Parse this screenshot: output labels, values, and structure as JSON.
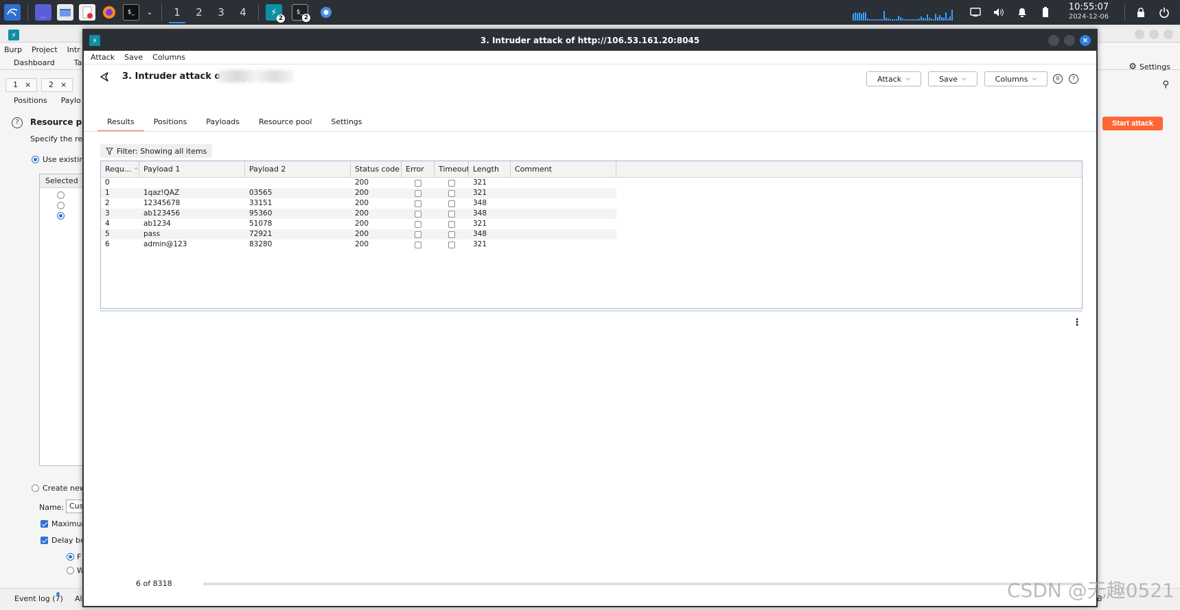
{
  "taskbar": {
    "workspaces": [
      "1",
      "2",
      "3",
      "4"
    ],
    "active_workspace": "1",
    "burp_badge": "2",
    "terminal_badge": "2",
    "clock_time": "10:55:07",
    "clock_date": "2024-12-06"
  },
  "background_app": {
    "menu": [
      "Burp",
      "Project",
      "Intr"
    ],
    "tabs": [
      "Dashboard",
      "Ta"
    ],
    "number_tabs": [
      "1",
      "2"
    ],
    "subtabs": [
      "Positions",
      "Paylo"
    ],
    "section_title": "Resource poo",
    "section_desc": "Specify the reso",
    "use_existing": "Use existing",
    "selected_header": "Selected",
    "create_new": "Create new",
    "name_label": "Name:",
    "name_value": "Cus",
    "maximum_label": "Maximun",
    "delay_label": "Delay bet",
    "radio_f": "F",
    "radio_w": "W",
    "settings_label": "Settings",
    "start_attack": "Start attack",
    "event_log": "Event log (7)",
    "all_label": "Al",
    "bottom_right_label": "B"
  },
  "window": {
    "title": "3. Intruder attack of http://106.53.161.20:8045",
    "menu": [
      "Attack",
      "Save",
      "Columns"
    ],
    "heading": "3. Intruder attack of http",
    "buttons": {
      "attack": "Attack",
      "save": "Save",
      "columns": "Columns"
    },
    "tabs": [
      "Results",
      "Positions",
      "Payloads",
      "Resource pool",
      "Settings"
    ],
    "active_tab": "Results",
    "filter_text": "Filter: Showing all items",
    "columns": [
      "Requ...",
      "Payload 1",
      "Payload 2",
      "Status code",
      "Error",
      "Timeout",
      "Length",
      "Comment"
    ],
    "rows": [
      {
        "request": "0",
        "payload1": "",
        "payload2": "",
        "status": "200",
        "error": false,
        "timeout": false,
        "length": "321",
        "comment": ""
      },
      {
        "request": "1",
        "payload1": "1qaz!QAZ",
        "payload2": "03565",
        "status": "200",
        "error": false,
        "timeout": false,
        "length": "321",
        "comment": ""
      },
      {
        "request": "2",
        "payload1": "12345678",
        "payload2": "33151",
        "status": "200",
        "error": false,
        "timeout": false,
        "length": "348",
        "comment": ""
      },
      {
        "request": "3",
        "payload1": "ab123456",
        "payload2": "95360",
        "status": "200",
        "error": false,
        "timeout": false,
        "length": "348",
        "comment": ""
      },
      {
        "request": "4",
        "payload1": "ab1234",
        "payload2": "51078",
        "status": "200",
        "error": false,
        "timeout": false,
        "length": "321",
        "comment": ""
      },
      {
        "request": "5",
        "payload1": "pass",
        "payload2": "72921",
        "status": "200",
        "error": false,
        "timeout": false,
        "length": "348",
        "comment": ""
      },
      {
        "request": "6",
        "payload1": "admin@123",
        "payload2": "83280",
        "status": "200",
        "error": false,
        "timeout": false,
        "length": "321",
        "comment": ""
      }
    ],
    "progress_text": "6 of 8318",
    "progress_fraction": 0.00072
  },
  "watermark": "CSDN @无趣0521",
  "colors": {
    "accent": "#ff6633",
    "selection": "#2f6fd0",
    "taskbar": "#2b2f36"
  }
}
